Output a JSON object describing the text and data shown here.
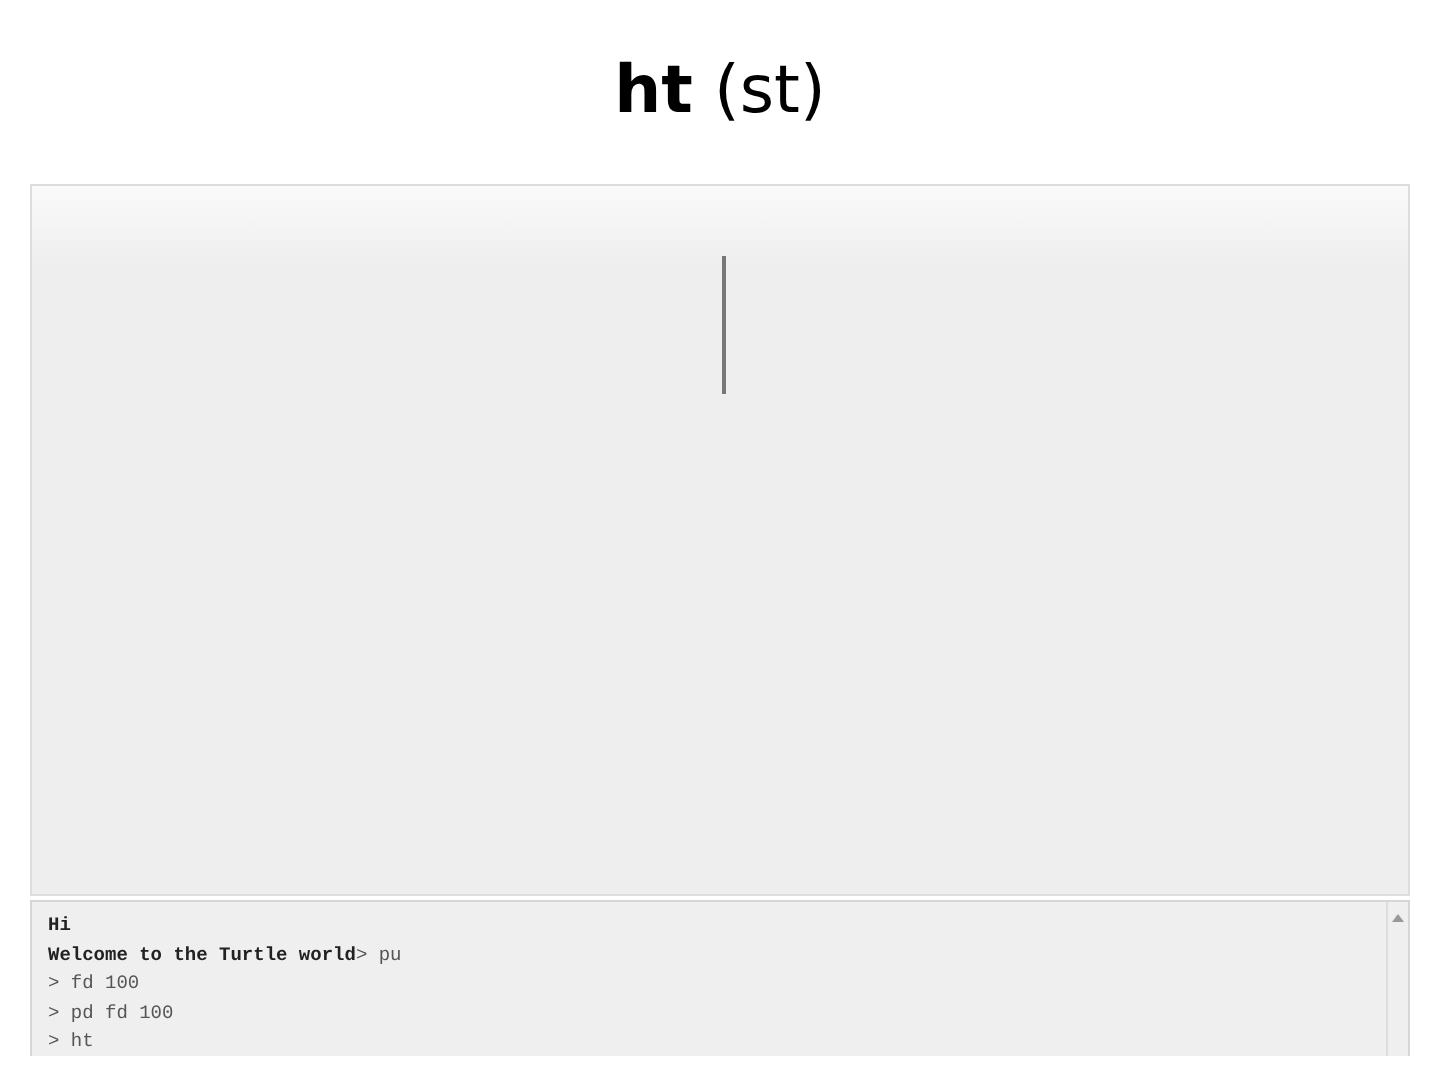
{
  "slide_title": "**ht** (st)",
  "console": {
    "lines": [
      {
        "kind": "output",
        "text": "Hi"
      },
      {
        "kind": "input",
        "text": "**Welcome to the Turtle world**> pu"
      },
      {
        "kind": "input",
        "text": "> fd 100"
      },
      {
        "kind": "input",
        "text": "> pd fd 100"
      },
      {
        "kind": "input",
        "text": "> ht"
      }
    ]
  }
}
